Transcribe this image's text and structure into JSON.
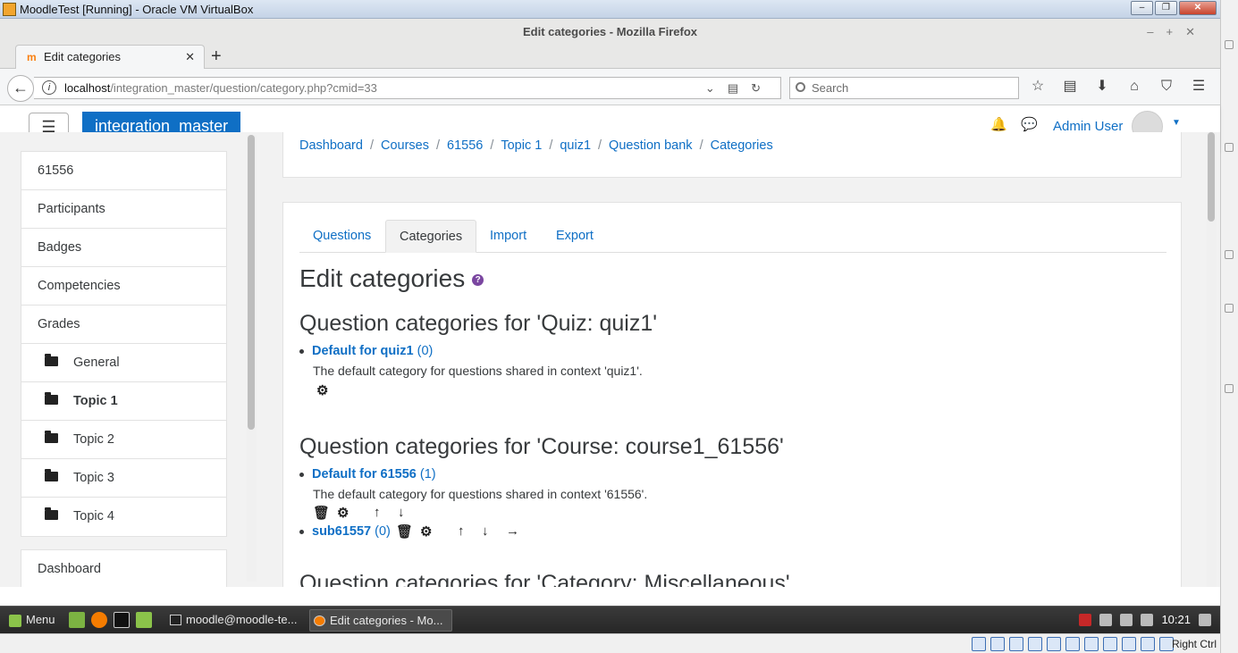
{
  "vbox": {
    "title": "MoodleTest [Running] - Oracle VM VirtualBox",
    "host_key": "Right Ctrl"
  },
  "firefox": {
    "window_title": "Edit categories - Mozilla Firefox",
    "tab_title": "Edit categories",
    "url_host": "localhost",
    "url_path": "/integration_master/question/category.php?cmid=33",
    "search_placeholder": "Search"
  },
  "moodle": {
    "site_name": "integration_master",
    "user_name": "Admin User",
    "drawer": [
      {
        "label": "61556",
        "sub": false,
        "bold": false
      },
      {
        "label": "Participants",
        "sub": false,
        "bold": false
      },
      {
        "label": "Badges",
        "sub": false,
        "bold": false
      },
      {
        "label": "Competencies",
        "sub": false,
        "bold": false
      },
      {
        "label": "Grades",
        "sub": false,
        "bold": false
      },
      {
        "label": "General",
        "sub": true,
        "bold": false
      },
      {
        "label": "Topic 1",
        "sub": true,
        "bold": true
      },
      {
        "label": "Topic 2",
        "sub": true,
        "bold": false
      },
      {
        "label": "Topic 3",
        "sub": true,
        "bold": false
      },
      {
        "label": "Topic 4",
        "sub": true,
        "bold": false
      }
    ],
    "drawer2": [
      {
        "label": "Dashboard"
      }
    ],
    "breadcrumb": [
      "Dashboard",
      "Courses",
      "61556",
      "Topic 1",
      "quiz1",
      "Question bank",
      "Categories"
    ],
    "tabs": [
      "Questions",
      "Categories",
      "Import",
      "Export"
    ],
    "active_tab": "Categories",
    "heading": "Edit categories",
    "sections": [
      {
        "title": "Question categories for 'Quiz: quiz1'",
        "categories": [
          {
            "name": "Default for quiz1",
            "count": "(0)",
            "desc": "The default category for questions shared in context 'quiz1'."
          }
        ]
      },
      {
        "title": "Question categories for 'Course: course1_61556'",
        "categories": [
          {
            "name": "Default for 61556",
            "count": "(1)",
            "desc": "The default category for questions shared in context '61556'."
          },
          {
            "name": "sub61557",
            "count": "(0)",
            "desc": ""
          }
        ]
      },
      {
        "title": "Question categories for 'Category: Miscellaneous'",
        "categories": []
      }
    ]
  },
  "taskbar": {
    "menu_label": "Menu",
    "terminal_task": "moodle@moodle-te...",
    "firefox_task": "Edit categories - Mo...",
    "clock": "10:21"
  }
}
